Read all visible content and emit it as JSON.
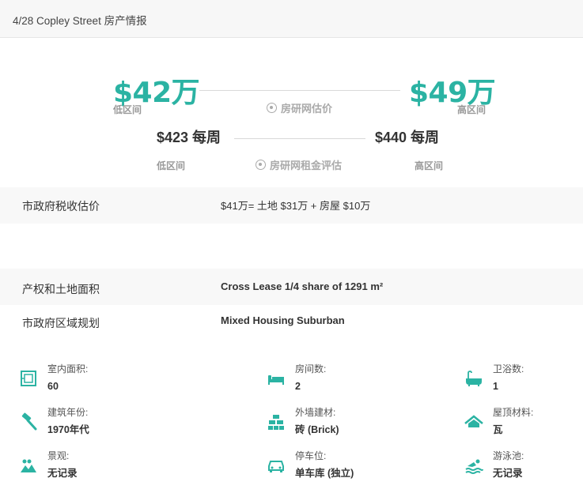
{
  "header": {
    "title": "4/28 Copley Street 房产情报"
  },
  "valuation": {
    "low_price": "$42万",
    "low_label": "低区间",
    "high_price": "$49万",
    "high_label": "高区间",
    "brand_label": "房研网估价"
  },
  "rent": {
    "low_price": "$423 每周",
    "low_label": "低区间",
    "high_price": "$440 每周",
    "high_label": "高区间",
    "brand_label": "房研网租金评估"
  },
  "info": [
    {
      "label": "市政府税收估价",
      "value": "$41万= 土地 $31万 + 房屋 $10万"
    },
    {
      "label": "产权和土地面积",
      "value": "Cross Lease 1/4 share of 1291 m²"
    },
    {
      "label": "市政府区域规划",
      "value": "Mixed Housing Suburban"
    }
  ],
  "features": [
    {
      "icon": "floor-area-icon",
      "label": "室内面积:",
      "value": "60"
    },
    {
      "icon": "bed-icon",
      "label": "房间数:",
      "value": "2"
    },
    {
      "icon": "bathtub-icon",
      "label": "卫浴数:",
      "value": "1"
    },
    {
      "icon": "hammer-icon",
      "label": "建筑年份:",
      "value": "1970年代"
    },
    {
      "icon": "bricks-icon",
      "label": "外墙建材:",
      "value": "砖 (Brick)"
    },
    {
      "icon": "roof-icon",
      "label": "屋顶材料:",
      "value": "瓦"
    },
    {
      "icon": "landscape-icon",
      "label": "景观:",
      "value": "无记录"
    },
    {
      "icon": "car-icon",
      "label": "停车位:",
      "value": "单车库 (独立)"
    },
    {
      "icon": "swimmer-icon",
      "label": "游泳池:",
      "value": "无记录"
    }
  ],
  "colors": {
    "accent": "#2bb3a3",
    "muted": "#999999",
    "row_bg": "#f8f8f8"
  }
}
